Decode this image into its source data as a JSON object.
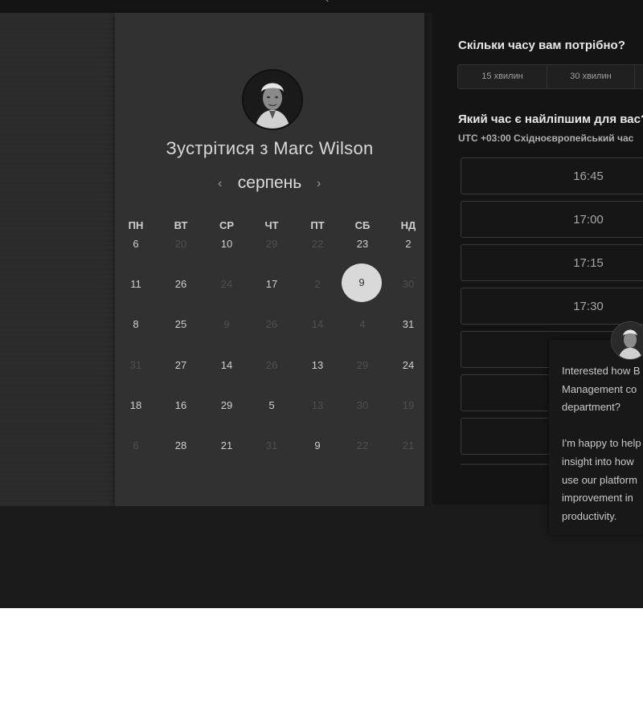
{
  "booking": {
    "title": "Зустрітися з Marc Wilson",
    "month": "серпень",
    "prev_arrow": "‹",
    "next_arrow": "›",
    "weekdays": [
      "ПН",
      "ВТ",
      "СР",
      "ЧТ",
      "ПТ",
      "СБ",
      "НД"
    ],
    "weeks": [
      [
        {
          "d": "6",
          "on": true
        },
        {
          "d": "20",
          "on": false
        },
        {
          "d": "10",
          "on": true
        },
        {
          "d": "29",
          "on": false
        },
        {
          "d": "22",
          "on": false
        },
        {
          "d": "23",
          "on": true
        },
        {
          "d": "2",
          "on": true
        }
      ],
      [
        {
          "d": "11",
          "on": true
        },
        {
          "d": "26",
          "on": true
        },
        {
          "d": "24",
          "on": false
        },
        {
          "d": "17",
          "on": true
        },
        {
          "d": "2",
          "on": false
        },
        {
          "d": "9",
          "on": true,
          "selected": true
        },
        {
          "d": "30",
          "on": false
        }
      ],
      [
        {
          "d": "8",
          "on": true
        },
        {
          "d": "25",
          "on": true
        },
        {
          "d": "9",
          "on": false
        },
        {
          "d": "26",
          "on": false
        },
        {
          "d": "14",
          "on": false
        },
        {
          "d": "4",
          "on": false
        },
        {
          "d": "31",
          "on": true
        }
      ],
      [
        {
          "d": "31",
          "on": false
        },
        {
          "d": "27",
          "on": true
        },
        {
          "d": "14",
          "on": true
        },
        {
          "d": "26",
          "on": false
        },
        {
          "d": "13",
          "on": true
        },
        {
          "d": "29",
          "on": false
        },
        {
          "d": "24",
          "on": true
        }
      ],
      [
        {
          "d": "18",
          "on": true
        },
        {
          "d": "16",
          "on": true
        },
        {
          "d": "29",
          "on": true
        },
        {
          "d": "5",
          "on": true
        },
        {
          "d": "13",
          "on": false
        },
        {
          "d": "30",
          "on": false
        },
        {
          "d": "19",
          "on": false
        }
      ],
      [
        {
          "d": "6",
          "on": false
        },
        {
          "d": "28",
          "on": true
        },
        {
          "d": "21",
          "on": true
        },
        {
          "d": "31",
          "on": false
        },
        {
          "d": "9",
          "on": true
        },
        {
          "d": "22",
          "on": false
        },
        {
          "d": "21",
          "on": false
        }
      ]
    ]
  },
  "scheduler": {
    "duration_question": "Скільки часу вам потрібно?",
    "durations": [
      "15 хвилин",
      "30 хвилин",
      ""
    ],
    "time_question": "Який час є найліпшим для вас?",
    "timezone": "UTC +03:00 Східноєвропейський час",
    "slots": [
      "16:45",
      "17:00",
      "17:15",
      "17:30",
      "",
      "",
      ""
    ]
  },
  "chat": {
    "message": "Interested how B\nManagement co\ndepartment?\n\nI'm happy to help\ninsight into how\nuse our platform\nimprovement in\nproductivity."
  },
  "colors": {
    "selected_day_bg": "#d9d9d9",
    "panel_bg": "#313131",
    "right_panel_bg": "#141414"
  }
}
